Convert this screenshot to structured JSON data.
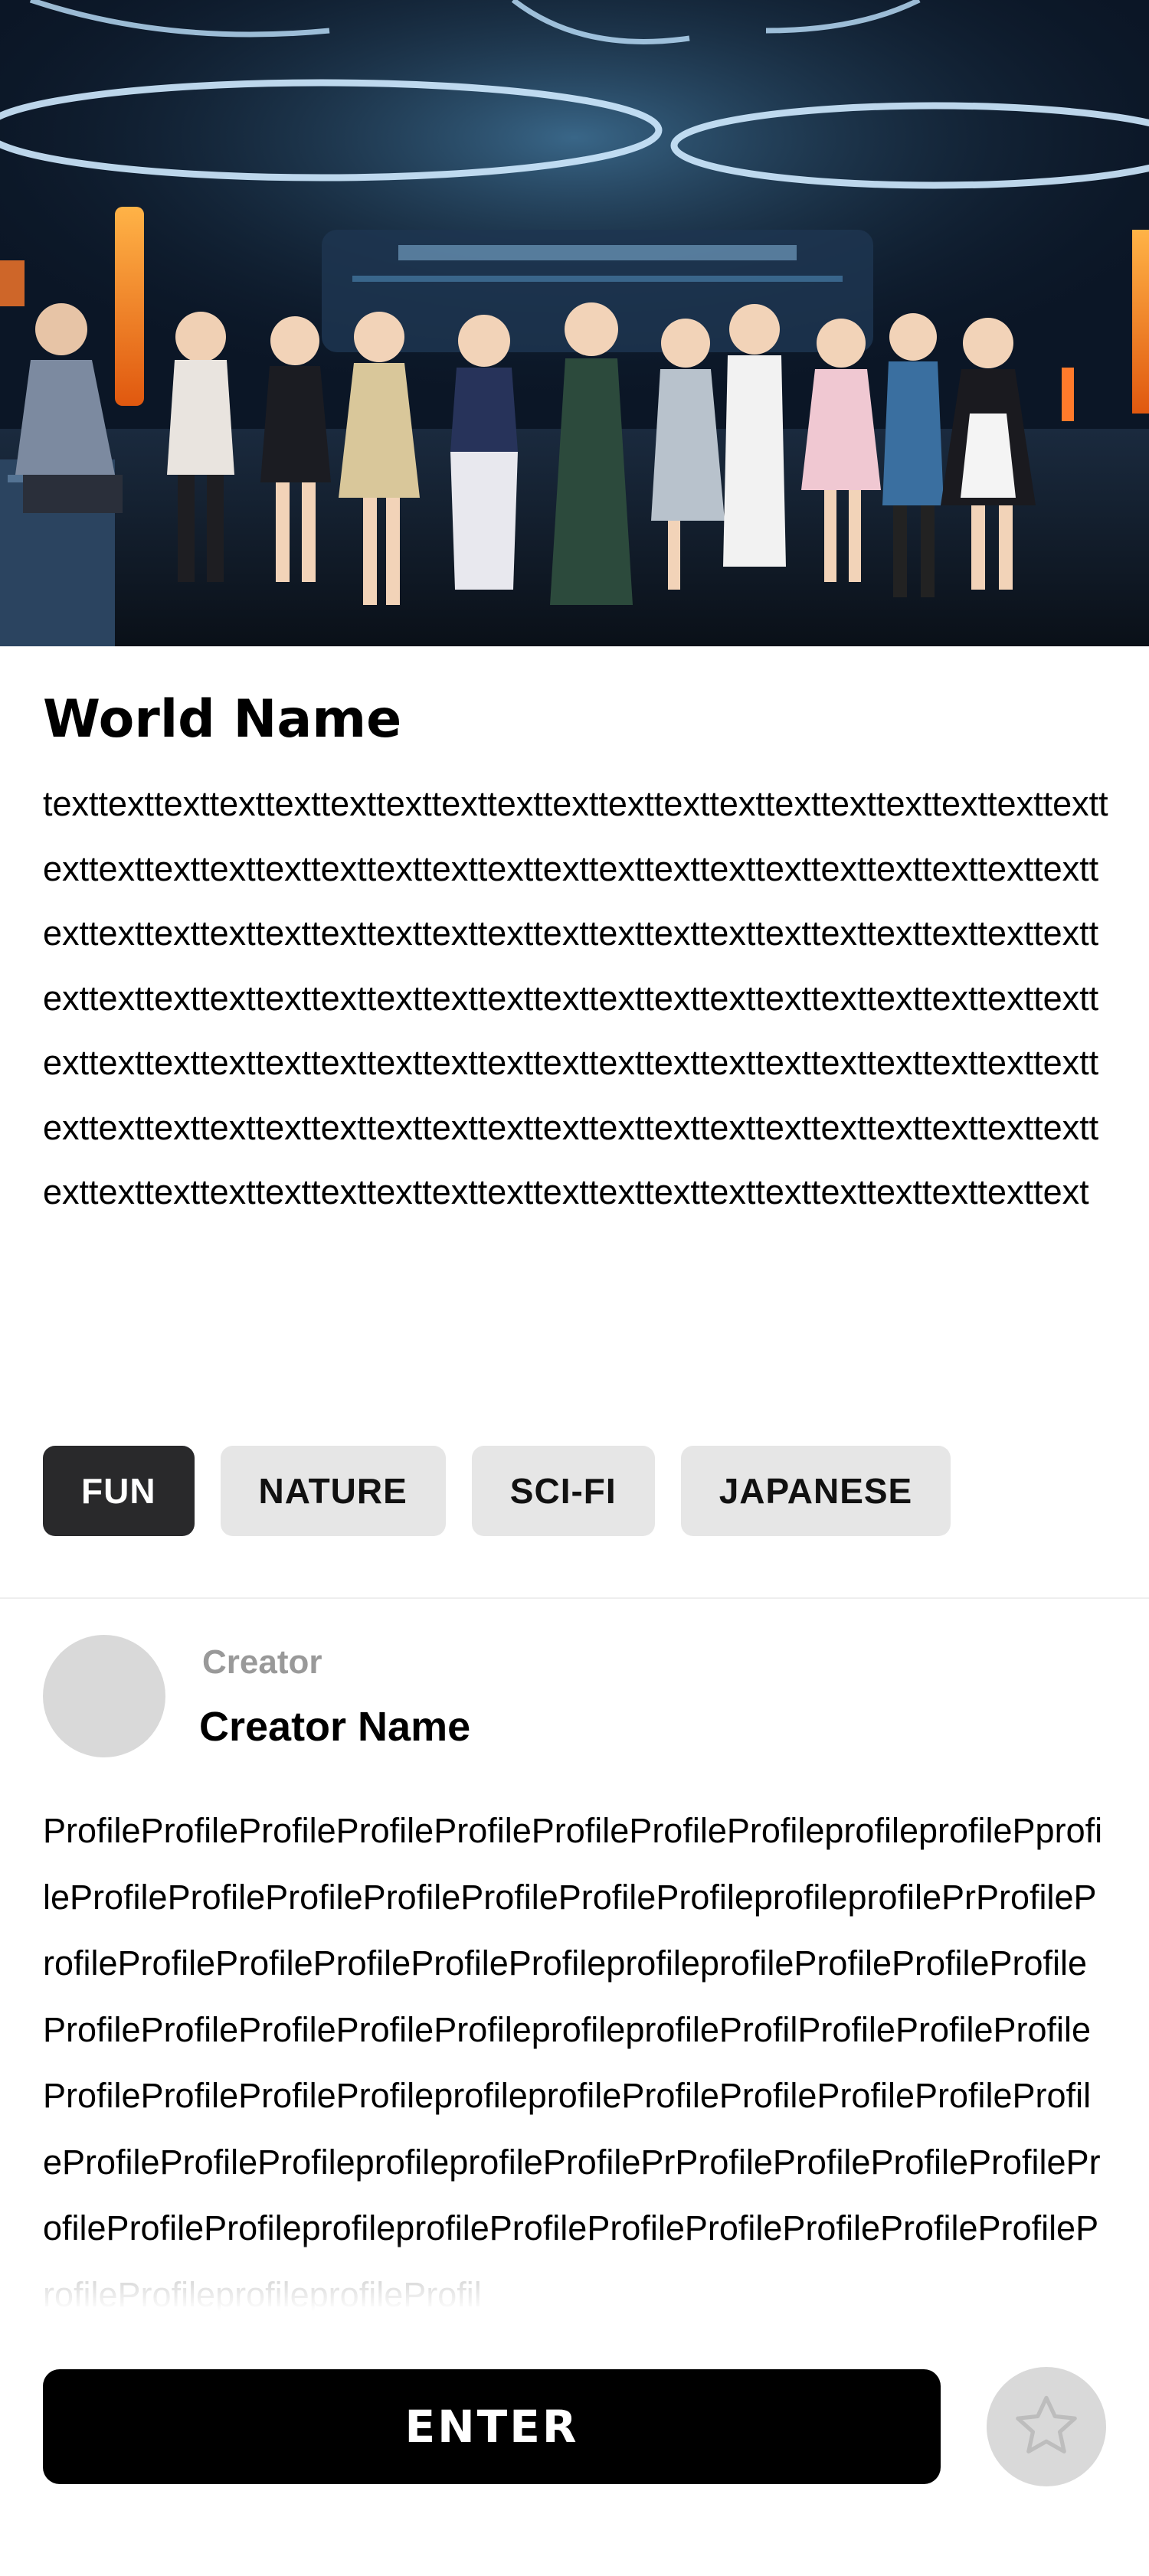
{
  "world": {
    "title": "World Name",
    "description": "texttexttexttexttexttexttexttexttexttexttexttexttexttexttexttexttexttexttexttexttexttexttexttexttexttexttexttexttexttexttexttexttexttexttexttexttexttexttexttexttexttexttexttexttexttexttexttexttexttexttexttexttexttexttexttexttexttexttexttexttexttexttexttexttexttexttexttexttexttexttexttexttexttexttexttexttexttexttexttexttexttexttexttexttexttexttexttexttexttexttexttexttexttexttexttexttexttexttexttexttexttexttexttexttexttexttexttexttexttexttexttexttexttexttexttexttexttexttexttexttexttexttexttexttexttexttexttexttexttexttexttexttext"
  },
  "tags": [
    {
      "label": "FUN",
      "active": true
    },
    {
      "label": "NATURE",
      "active": false
    },
    {
      "label": "SCI-FI",
      "active": false
    },
    {
      "label": "JAPANESE",
      "active": false
    }
  ],
  "creator": {
    "caption": "Creator",
    "name": "Creator Name",
    "profile": "ProfileProfileProfileProfileProfileProfileProfileProfileprofileprofilePprofileProfileProfileProfileProfileProfileProfileProfileprofileprofilePrProfileProfileProfileProfileProfileProfileProfileprofileprofileProfileProfileProfileProfileProfileProfileProfileProfileprofileprofileProfilProfileProfileProfileProfileProfileProfileProfileprofileprofileProfileProfileProfileProfileProfileProfileProfileProfileprofileprofileProfilePrProfileProfileProfileProfileProfileProfileProfileprofileprofileProfileProfileProfileProfileProfileProfileProfileProfileprofileprofileProfil"
  },
  "actions": {
    "enter_label": "ENTER",
    "favorite_icon": "star-icon"
  },
  "colors": {
    "active_tag_bg": "#29292b",
    "tag_bg": "#e6e6e6",
    "enter_bg": "#000000",
    "avatar_placeholder": "#d9d9d9",
    "caption_gray": "#999999"
  }
}
